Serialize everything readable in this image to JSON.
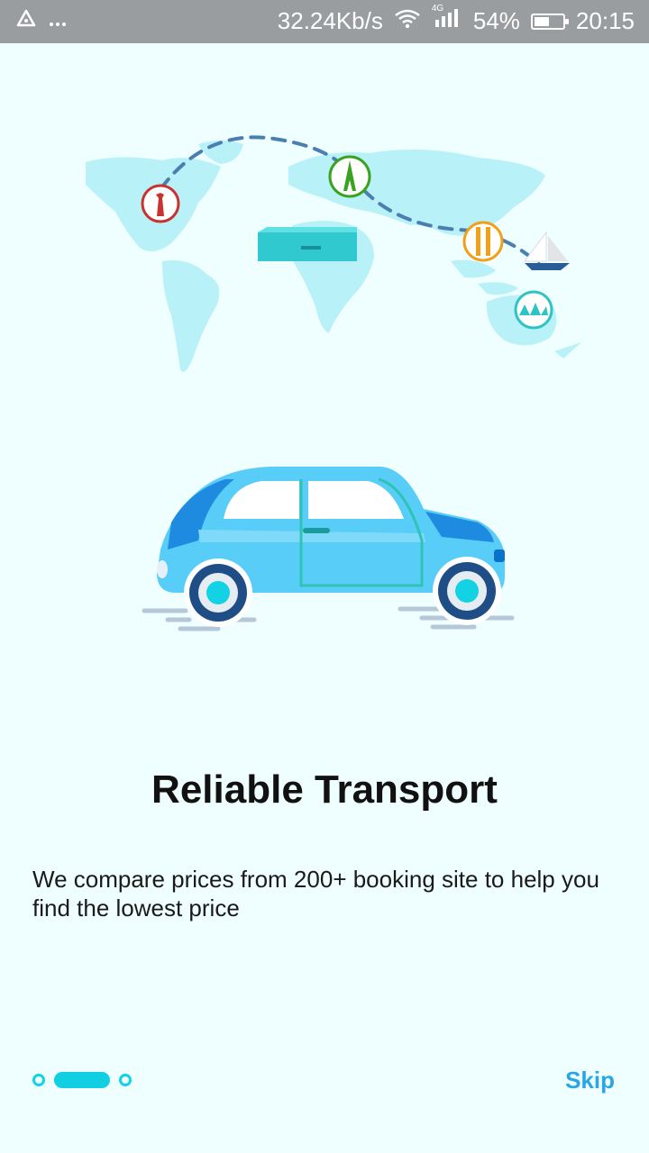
{
  "status_bar": {
    "speed": "32.24Kb/s",
    "battery_percent": "54%",
    "time": "20:15",
    "battery_level": 0.54,
    "network_label": "4G",
    "icons": [
      "alert-triangle-icon",
      "more-dots-icon",
      "wifi-icon",
      "signal-icon",
      "battery-icon"
    ]
  },
  "onboarding": {
    "title": "Reliable Transport",
    "description": "We compare prices from 200+ booking site to help you find the lowest price",
    "skip_label": "Skip",
    "pages": 3,
    "current_page": 2
  },
  "illustrations": {
    "map": "world-map-illustration",
    "car": "car-illustration"
  },
  "colors": {
    "background": "#effefe",
    "accent": "#11cfe3",
    "skip": "#2aa6e6",
    "statusbar": "#9a9da0"
  }
}
